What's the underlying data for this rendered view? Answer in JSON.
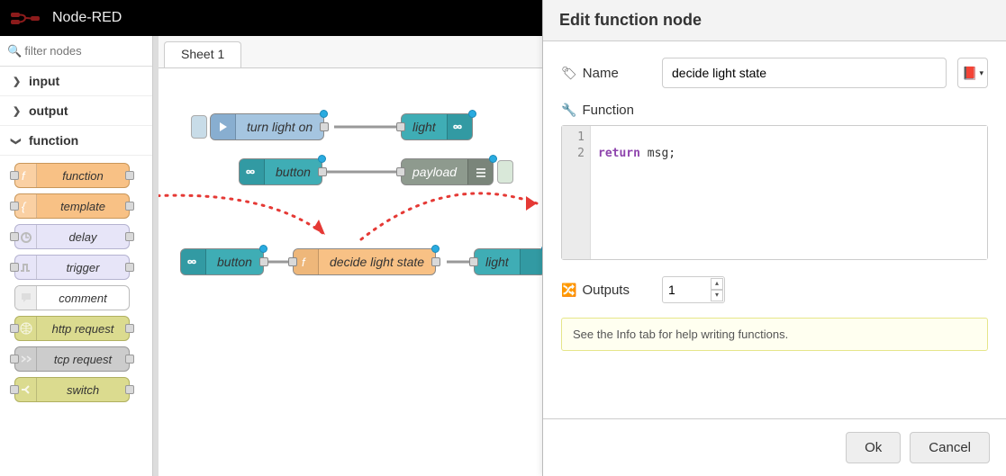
{
  "header": {
    "title": "Node-RED"
  },
  "palette": {
    "filter_placeholder": "filter nodes",
    "categories": {
      "input": {
        "label": "input",
        "expanded": false
      },
      "output": {
        "label": "output",
        "expanded": false
      },
      "function": {
        "label": "function",
        "expanded": true
      }
    },
    "function_items": [
      {
        "name": "function",
        "bg": "orange",
        "icon": "function"
      },
      {
        "name": "template",
        "bg": "orange",
        "icon": "template"
      },
      {
        "name": "delay",
        "bg": "lav",
        "icon": "delay"
      },
      {
        "name": "trigger",
        "bg": "lav",
        "icon": "trigger"
      },
      {
        "name": "comment",
        "bg": "white",
        "icon": "comment"
      },
      {
        "name": "http request",
        "bg": "olive",
        "icon": "globe"
      },
      {
        "name": "tcp request",
        "bg": "grey",
        "icon": "tcp"
      },
      {
        "name": "switch",
        "bg": "olive",
        "icon": "switch"
      }
    ]
  },
  "workspace": {
    "tab": "Sheet 1",
    "nodes": {
      "turn_light_on": "turn light on",
      "light1": "light",
      "button1": "button",
      "payload": "payload",
      "button2": "button",
      "decide": "decide light state",
      "light2": "light"
    }
  },
  "tray": {
    "title": "Edit function node",
    "name_label": "Name",
    "name_value": "decide light state",
    "function_label": "Function",
    "code_lines": [
      "1",
      "2"
    ],
    "code_keyword": "return",
    "code_rest": " msg;",
    "outputs_label": "Outputs",
    "outputs_value": "1",
    "info_tip": "See the Info tab for help writing functions.",
    "ok_label": "Ok",
    "cancel_label": "Cancel"
  }
}
